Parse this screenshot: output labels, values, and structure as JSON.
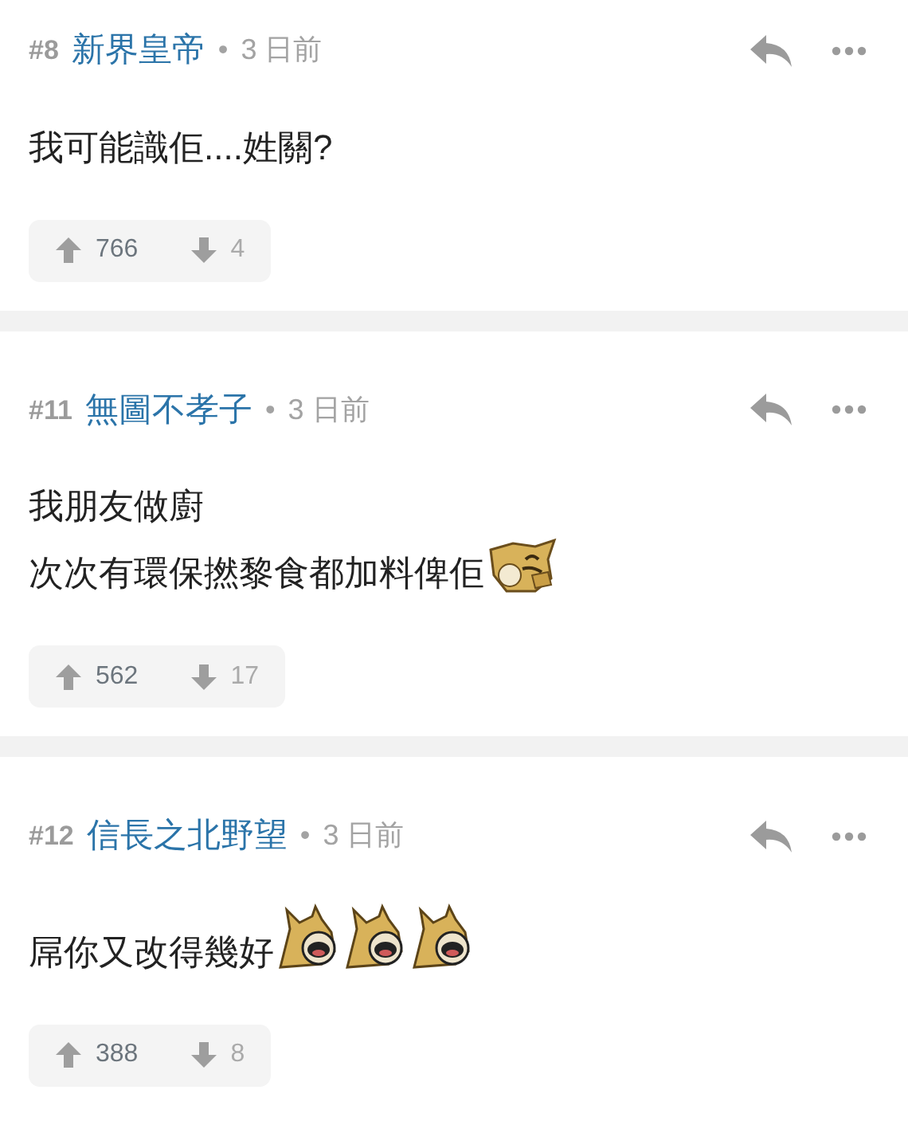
{
  "posts": [
    {
      "number": "#8",
      "username": "新界皇帝",
      "separator": "•",
      "time": "3 日前",
      "body": [
        [
          {
            "kind": "text",
            "text": "我可能識佢....姓關?"
          }
        ]
      ],
      "upvotes": "766",
      "downvotes": "4"
    },
    {
      "number": "#11",
      "username": "無圖不孝子",
      "separator": "•",
      "time": "3 日前",
      "body": [
        [
          {
            "kind": "text",
            "text": "我朋友做廚"
          }
        ],
        [
          {
            "kind": "text",
            "text": "次次有環保撚黎食都加料俾佢"
          },
          {
            "kind": "emoji_shy"
          }
        ]
      ],
      "upvotes": "562",
      "downvotes": "17"
    },
    {
      "number": "#12",
      "username": "信長之北野望",
      "separator": "•",
      "time": "3 日前",
      "body": [
        [
          {
            "kind": "text",
            "text": "屌你又改得幾好"
          },
          {
            "kind": "emoji_shout"
          },
          {
            "kind": "emoji_shout"
          },
          {
            "kind": "emoji_shout"
          }
        ]
      ],
      "upvotes": "388",
      "downvotes": "8"
    }
  ]
}
